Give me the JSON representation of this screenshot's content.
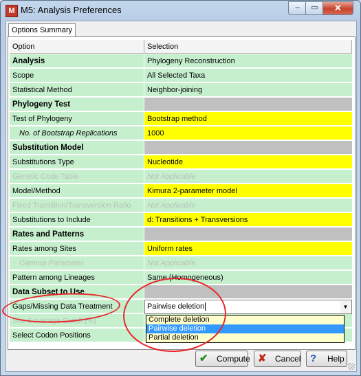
{
  "window": {
    "title": "M5: Analysis Preferences",
    "app_icon_label": "M",
    "minimize_glyph": "–",
    "maximize_glyph": "▭",
    "close_glyph": "✕"
  },
  "tab": {
    "label": "Options Summary"
  },
  "grid": {
    "header": {
      "option": "Option",
      "selection": "Selection"
    },
    "rows": [
      {
        "option": "Analysis",
        "selection": "Phylogeny Reconstruction"
      },
      {
        "option": "Scope",
        "selection": "All Selected Taxa"
      },
      {
        "option": "Statistical Method",
        "selection": "Neighbor-joining"
      },
      {
        "option": "Phylogeny Test",
        "selection": ""
      },
      {
        "option": "Test of Phylogeny",
        "selection": "Bootstrap method"
      },
      {
        "option": "No. of Bootstrap Replications",
        "selection": "1000"
      },
      {
        "option": "Substitution Model",
        "selection": ""
      },
      {
        "option": "Substitutions Type",
        "selection": "Nucleotide"
      },
      {
        "option": "Genetic Code Table",
        "selection": "Not Applicable"
      },
      {
        "option": "Model/Method",
        "selection": "Kimura 2-parameter model"
      },
      {
        "option": "Fixed Transition/Transversion Ratio",
        "selection": "Not Applicable"
      },
      {
        "option": "Substitutions to Include",
        "selection": "d: Transitions + Transversions"
      },
      {
        "option": "Rates and Patterns",
        "selection": ""
      },
      {
        "option": "Rates among Sites",
        "selection": "Uniform rates"
      },
      {
        "option": "Gamma Parameter",
        "selection": "Not Applicable"
      },
      {
        "option": "Pattern among Lineages",
        "selection": "Same (Homogeneous)"
      },
      {
        "option": "Data Subset to Use",
        "selection": ""
      },
      {
        "option": "Gaps/Missing Data Treatment",
        "selection": "Pairwise deletion"
      },
      {
        "option": "Site Coverage Cutoff (%)",
        "selection": ""
      },
      {
        "option": "Select Codon Positions",
        "selection": ""
      }
    ]
  },
  "gaps_dropdown": {
    "current_value": "Pairwise deletion",
    "arrow_glyph": "▼",
    "options": [
      "Complete deletion",
      "Pairwise deletion",
      "Partial deletion"
    ],
    "highlighted": "Pairwise deletion"
  },
  "buttons": {
    "compute": {
      "label": "Compute",
      "icon": "check-icon",
      "glyph": "✔"
    },
    "cancel": {
      "label": "Cancel",
      "icon": "x-icon",
      "glyph": "✘"
    },
    "help": {
      "label": "Help",
      "icon": "question-icon",
      "glyph": "?"
    }
  },
  "colors": {
    "row_green": "#c6efce",
    "selection_yellow": "#ffff00",
    "section_grey": "#c0c0c0",
    "annotation_red": "#e8262a",
    "list_highlight": "#3399ff"
  }
}
